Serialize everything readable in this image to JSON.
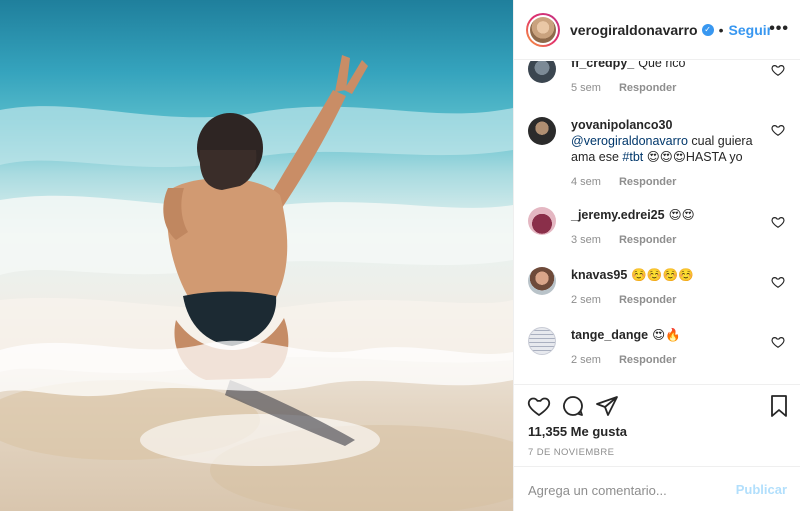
{
  "post": {
    "username": "verogiraldonavarro",
    "follow_label": "Seguir",
    "dot": "•",
    "more_label": "•••",
    "likes": "11,355 Me gusta",
    "date": "7 DE NOVIEMBRE"
  },
  "comments": [
    {
      "user": "ff_credpy_",
      "text": "Que rico",
      "time": "5 sem",
      "reply": "Responder"
    },
    {
      "user": "yovanipolanco30",
      "mention": "@verogiraldonavarro",
      "text_a": " cual guiera ama ese ",
      "tag": "#tbt",
      "text_b": " 😍😍😍HASTA yo",
      "time": "4 sem",
      "reply": "Responder"
    },
    {
      "user": "_jeremy.edrei25",
      "text": "😍😍",
      "time": "3 sem",
      "reply": "Responder"
    },
    {
      "user": "knavas95",
      "text": "☺️☺️☺️☺️",
      "time": "2 sem",
      "reply": "Responder"
    },
    {
      "user": "tange_dange",
      "text": "😍🔥",
      "time": "2 sem",
      "reply": "Responder"
    }
  ],
  "add_comment": {
    "placeholder": "Agrega un comentario...",
    "publish_label": "Publicar"
  },
  "icons": {
    "verified": "verified-badge-icon",
    "heart": "heart-icon",
    "comment": "comment-icon",
    "share": "share-icon",
    "save": "bookmark-icon"
  },
  "colors": {
    "accent": "#3897f0",
    "publish_disabled": "#b2dffc",
    "muted": "#8e8e8e",
    "text": "#262626"
  }
}
